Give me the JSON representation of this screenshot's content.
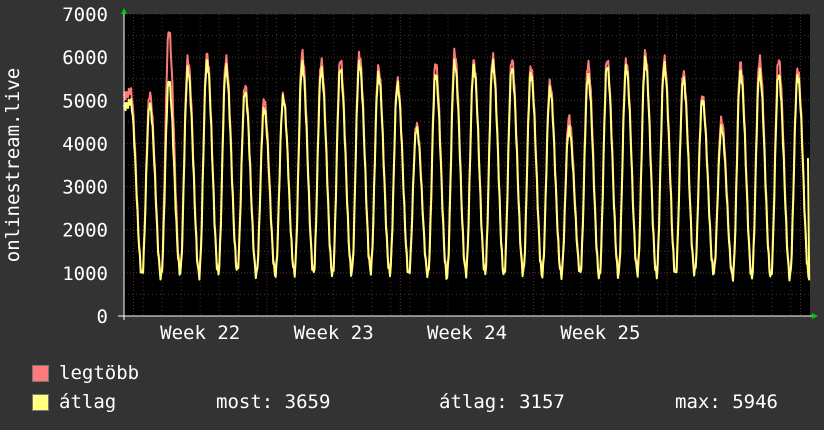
{
  "chart_data": {
    "type": "line",
    "ylabel": "onlinestream.live",
    "ylim": [
      0,
      7000
    ],
    "y_ticks": [
      0,
      1000,
      2000,
      3000,
      4000,
      5000,
      6000,
      7000
    ],
    "x_tick_labels": [
      "Week 22",
      "Week 23",
      "Week 24",
      "Week 25"
    ],
    "grid": true,
    "legend_placement": "bottom-left",
    "days": 36,
    "series": [
      {
        "name": "legtöbb",
        "color": "#ff7b7b",
        "daily_peaks": [
          5200,
          5150,
          6600,
          5950,
          6050,
          5950,
          5350,
          5000,
          5100,
          6100,
          5900,
          5950,
          6050,
          5750,
          5450,
          4450,
          5850,
          6100,
          5900,
          6000,
          5950,
          5750,
          5400,
          4600,
          5850,
          5950,
          5900,
          6100,
          5950,
          5650,
          5100,
          4550,
          5850,
          5950,
          5950,
          5700
        ],
        "daily_mins": [
          1000,
          950,
          1050,
          1000,
          1050,
          1100,
          1000,
          1000,
          1050,
          1050,
          1000,
          1050,
          1100,
          1050,
          1000,
          1000,
          950,
          1050,
          1050,
          1000,
          1050,
          1000,
          1000,
          1050,
          950,
          1000,
          1050,
          1000,
          1000,
          1050,
          1050,
          950,
          950
        ]
      },
      {
        "name": "átlag",
        "color": "#ffff80",
        "daily_peaks": [
          4950,
          4900,
          5450,
          5700,
          5900,
          5750,
          5200,
          4800,
          5050,
          5850,
          5700,
          5750,
          5850,
          5600,
          5350,
          4350,
          5600,
          5850,
          5800,
          5850,
          5750,
          5600,
          5250,
          4350,
          5550,
          5800,
          5750,
          5950,
          5800,
          5500,
          5000,
          4350,
          5650,
          5650,
          5600,
          5550
        ],
        "daily_mins": [
          950,
          900,
          1000,
          950,
          1000,
          1050,
          950,
          950,
          1000,
          1000,
          950,
          1000,
          1050,
          1000,
          950,
          950,
          900,
          1000,
          1000,
          950,
          1000,
          950,
          950,
          1000,
          900,
          950,
          1000,
          950,
          950,
          1000,
          1000,
          900,
          900
        ],
        "last_value": 3659
      }
    ]
  },
  "legend": {
    "max_label": "legtöbb",
    "avg_label": "átlag"
  },
  "stats": {
    "now": "most: 3659",
    "avg": "átlag: 3157",
    "max": "max: 5946"
  }
}
